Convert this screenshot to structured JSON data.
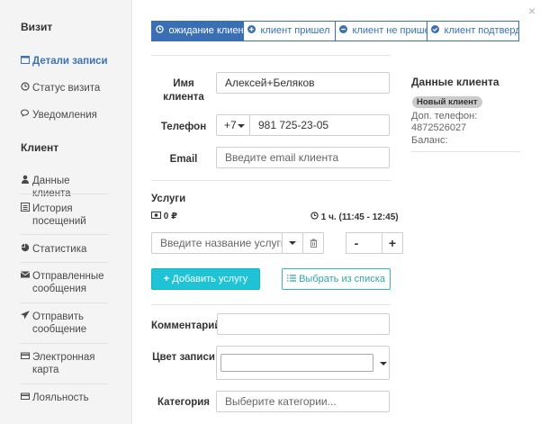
{
  "sidebar": {
    "visit_heading": "Визит",
    "client_heading": "Клиент",
    "items": [
      {
        "label": "Детали записи",
        "icon": "calendar-icon"
      },
      {
        "label": "Статус визита",
        "icon": "clock-icon"
      },
      {
        "label": "Уведомления",
        "icon": "comments-icon"
      },
      {
        "label": "Данные клиента",
        "icon": "user-icon"
      },
      {
        "label": "История посещений",
        "icon": "list-icon"
      },
      {
        "label": "Статистика",
        "icon": "pie-chart-icon"
      },
      {
        "label": "Отправленные сообщения",
        "icon": "envelope-icon"
      },
      {
        "label": "Отправить сообщение",
        "icon": "send-icon"
      },
      {
        "label": "Электронная карта",
        "icon": "card-icon"
      },
      {
        "label": "Лояльность",
        "icon": "card-icon"
      }
    ]
  },
  "status_tabs": [
    {
      "label": "ожидание клиента",
      "icon": "clock-icon",
      "active": true
    },
    {
      "label": "клиент пришел",
      "icon": "plus-circle-icon",
      "active": false
    },
    {
      "label": "клиент не пришел",
      "icon": "minus-circle-icon",
      "active": false
    },
    {
      "label": "клиент подтвердил",
      "icon": "check-circle-icon",
      "active": false
    }
  ],
  "form": {
    "name_label": "Имя клиента",
    "name_value": "Алексей+Беляков",
    "phone_label": "Телефон",
    "phone_code": "+7",
    "phone_value": "981 725-23-05",
    "email_label": "Email",
    "email_placeholder": "Введите email клиента",
    "services_heading": "Услуги",
    "price": "0 ₽",
    "duration": "1 ч. (11:45 - 12:45)",
    "service_placeholder": "Введите название услуги",
    "minus": "-",
    "plus": "+",
    "add_service": "Добавить услугу",
    "choose_from_list": "Выбрать из списка",
    "comment_label": "Комментарий",
    "color_label": "Цвет записи",
    "category_label": "Категория",
    "category_placeholder": "Выберите категории..."
  },
  "client_info": {
    "title": "Данные клиента",
    "badge": "Новый клиент",
    "extra_phone_label": "Доп. телефон:",
    "extra_phone": "4872526027",
    "balance_label": "Баланс:"
  },
  "colors": {
    "primary": "#3a6fb5",
    "cyan": "#1ec3d6",
    "teal": "#37b7b7"
  }
}
